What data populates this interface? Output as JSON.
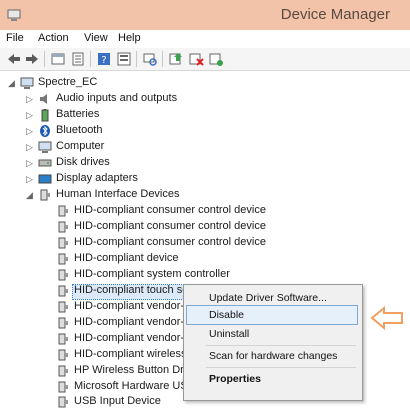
{
  "window": {
    "title": "Device Manager"
  },
  "menu": [
    "File",
    "Action",
    "View",
    "Help"
  ],
  "tree": {
    "root": "Spectre_EC",
    "categories": [
      "Audio inputs and outputs",
      "Batteries",
      "Bluetooth",
      "Computer",
      "Disk drives",
      "Display adapters",
      "Human Interface Devices"
    ],
    "hid_children": [
      "HID-compliant consumer control device",
      "HID-compliant consumer control device",
      "HID-compliant consumer control device",
      "HID-compliant device",
      "HID-compliant system controller",
      "HID-compliant touch screen",
      "HID-compliant vendor-",
      "HID-compliant vendor-",
      "HID-compliant vendor-",
      "HID-compliant wireless",
      "HP Wireless Button Driv",
      "Microsoft Hardware US",
      "USB Input Device"
    ]
  },
  "context_menu": {
    "items": [
      "Update Driver Software...",
      "Disable",
      "Uninstall",
      "Scan for hardware changes",
      "Properties"
    ],
    "highlighted": "Disable"
  },
  "colors": {
    "titlebar": "#f3c3a9",
    "highlight": "#e6f0fb",
    "callout": "#f0a060"
  }
}
